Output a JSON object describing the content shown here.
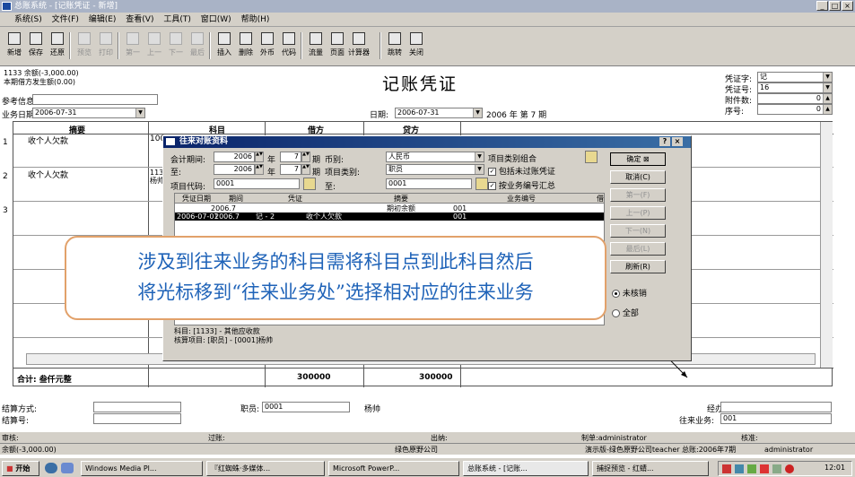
{
  "window": {
    "title": "总账系统 - [记账凭证 - 新增]",
    "min": "_",
    "max": "□",
    "close": "×"
  },
  "menu": [
    "系统(S)",
    "文件(F)",
    "编辑(E)",
    "查看(V)",
    "工具(T)",
    "窗口(W)",
    "帮助(H)"
  ],
  "toolbar": [
    {
      "label": "新增",
      "enabled": true,
      "icon": "new-icon"
    },
    {
      "label": "保存",
      "enabled": true,
      "icon": "save-icon"
    },
    {
      "label": "还原",
      "enabled": true,
      "icon": "restore-icon"
    },
    {
      "label": "预览",
      "enabled": false,
      "icon": "preview-icon"
    },
    {
      "label": "打印",
      "enabled": false,
      "icon": "print-icon"
    },
    {
      "label": "第一",
      "enabled": false,
      "icon": "first-icon"
    },
    {
      "label": "上一",
      "enabled": false,
      "icon": "prev-icon"
    },
    {
      "label": "下一",
      "enabled": false,
      "icon": "next-icon"
    },
    {
      "label": "最后",
      "enabled": false,
      "icon": "last-icon"
    },
    {
      "label": "插入",
      "enabled": true,
      "icon": "insert-icon"
    },
    {
      "label": "删除",
      "enabled": true,
      "icon": "delete-icon"
    },
    {
      "label": "外币",
      "enabled": true,
      "icon": "currency-icon"
    },
    {
      "label": "代码",
      "enabled": true,
      "icon": "code-icon"
    },
    {
      "label": "流量",
      "enabled": true,
      "icon": "flow-icon"
    },
    {
      "label": "页面",
      "enabled": true,
      "icon": "page-icon"
    },
    {
      "label": "计算器",
      "enabled": true,
      "icon": "calculator-icon"
    },
    {
      "label": "跳转",
      "enabled": true,
      "icon": "jump-icon"
    },
    {
      "label": "关闭",
      "enabled": true,
      "icon": "close-doc-icon"
    }
  ],
  "header": {
    "balance": "1133 余额(-3,000.00)",
    "period_debit": "本期借方发生额(0.00)",
    "title": "记账凭证",
    "ref_label": "参考信息:",
    "biz_date_label": "业务日期:",
    "biz_date": "2006-07-31",
    "date_label": "日期:",
    "date": "2006-07-31",
    "period_text": "2006 年 第 7 期",
    "voucher_word_label": "凭证字:",
    "voucher_word": "记",
    "voucher_no_label": "凭证号:",
    "voucher_no": "16",
    "attach_label": "附件数:",
    "attach": "0",
    "seq_label": "序号:",
    "seq": "0"
  },
  "table": {
    "headers": {
      "summary": "摘要",
      "subject": "科目",
      "debit": "借方",
      "credit": "贷方"
    },
    "rows": [
      {
        "no": "1",
        "summary": "收个人欠款",
        "subject": "100"
      },
      {
        "no": "2",
        "summary": "收个人欠款",
        "subject": "113\n杨帅"
      },
      {
        "no": "3",
        "summary": "",
        "subject": ""
      }
    ],
    "total_label": "合计: 叁仟元整",
    "total_debit": "300000",
    "total_credit": "300000"
  },
  "footer": {
    "settle_label": "结算方式:",
    "settle_no_label": "结算号:",
    "staff_label": "职员:",
    "staff": "0001",
    "staff_name": "杨帅",
    "handler_label": "经办:",
    "biz_label": "往来业务:",
    "biz": "001"
  },
  "statusbar": {
    "audit": "审核:",
    "post": "过账:",
    "cashier": "出纳:",
    "maker": "制单:administrator",
    "approver": "核准:",
    "balance": "余额(-3,000.00)",
    "company": "绿色原野公司",
    "edition": "演示版-绿色原野公司teacher",
    "ledger_period": "总账:2006年7期",
    "user": "administrator"
  },
  "dialog": {
    "title": "往来对账资料",
    "help": "?",
    "close": "×",
    "period_label": "会计期间:",
    "year_from": "2006",
    "period_from": "7",
    "year_to": "2006",
    "period_to": "7",
    "to_label": "至:",
    "year_unit": "年",
    "period_unit": "期",
    "currency_label": "币别:",
    "currency": "人民币",
    "item_type_label": "项目类别:",
    "item_type": "职员",
    "item_code_label": "项目代码:",
    "item_code_from": "0001",
    "item_code_to": "0001",
    "opt_combo": "项目类别组合",
    "opt_include": "包括未过账凭证",
    "opt_summary": "按业务编号汇总",
    "grid_headers": [
      "凭证日期",
      "期间",
      "凭证",
      "摘要",
      "业务编号",
      "借"
    ],
    "grid_rows": [
      [
        "",
        "2006.7",
        "",
        "期初余额",
        "001",
        ""
      ],
      [
        "2006-07-01",
        "2006.7",
        "记 - 2",
        "收个人欠款",
        "001",
        ""
      ]
    ],
    "subject_info": "科目: [1133] - 其他应收款",
    "calc_item_info": "核算项目: [职员] - [0001]杨帅",
    "buttons": {
      "ok": "确定",
      "cancel": "取消(C)",
      "first": "第一(F)",
      "prev": "上一(P)",
      "next": "下一(N)",
      "last": "最后(L)",
      "refresh": "刷新(R)"
    },
    "radio_unsettled": "未核销",
    "radio_all": "全部"
  },
  "callout": {
    "line1": "涉及到往来业务的科目需将科目点到此科目然后",
    "line2": "将光标移到“往来业务处”选择相对应的往来业务"
  },
  "taskbar": {
    "start": "开始",
    "items": [
      "Windows Media Pl...",
      "『红蜘蛛·多媒体...",
      "Microsoft PowerP...",
      "总账系统 - [记账...",
      "捕捉预览 - 红蜻..."
    ],
    "clock": "12:01"
  },
  "colors": {
    "dialog_title": "#0a246a",
    "callout_border": "#e2a16a",
    "callout_text": "#1f63b8",
    "selected_row": "#000000"
  }
}
